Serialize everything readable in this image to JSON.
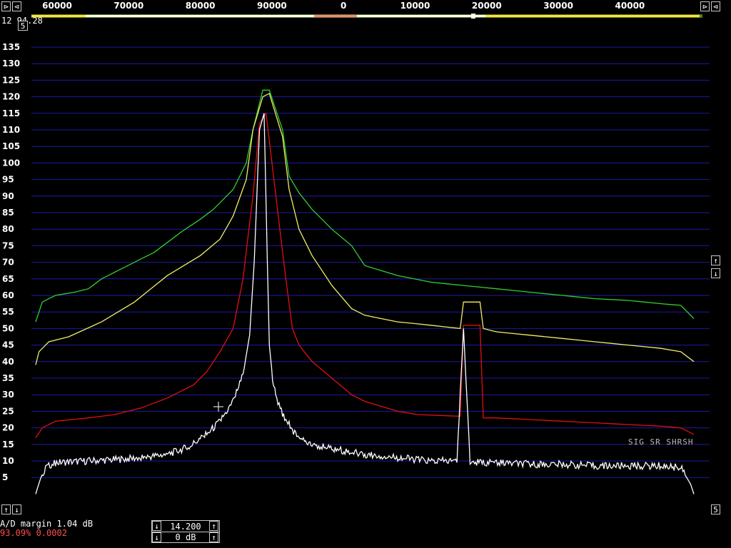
{
  "controls": {
    "left_scroll_top": "⊳",
    "left_arrow_top": "⊲",
    "right_scroll_top": "⊳",
    "right_arrow_top": "⊲",
    "top_readout": "12 94.28",
    "scale_btn_top": "5",
    "up_btn_left": "↑",
    "down_btn_left": "↓",
    "up_btn_right": "↑",
    "down_btn_right": "↓",
    "scale_btn_bottom": "5"
  },
  "status": {
    "ad_margin": "A/D margin  1.04 dB",
    "stats": "93.09% 0.0002",
    "overlay_text": "SIG SR SHRSH"
  },
  "bottom_controls": {
    "frequency": "14.200",
    "gain": "0 dB",
    "up_symbol": "↑",
    "down_symbol": "↓"
  },
  "colors": {
    "background": "#000000",
    "grid": "#1a1aa8",
    "white_trace": "#ffffff",
    "red_trace": "#e01010",
    "yellow_trace": "#f0f060",
    "green_trace": "#30d030"
  },
  "chart_data": {
    "type": "line",
    "x_tick_labels": [
      "60000",
      "70000",
      "80000",
      "90000",
      "0",
      "10000",
      "20000",
      "30000",
      "40000"
    ],
    "y_ticks": [
      135,
      130,
      125,
      120,
      115,
      110,
      105,
      100,
      95,
      90,
      85,
      80,
      75,
      70,
      65,
      60,
      55,
      50,
      45,
      40,
      35,
      30,
      25,
      20,
      15,
      10,
      5
    ],
    "ylim": [
      0,
      140
    ],
    "x_index_range": [
      0,
      100
    ],
    "grid": true,
    "series": [
      {
        "color": "#30d030",
        "x": [
          0,
          1,
          3,
          6,
          8,
          10,
          12,
          15,
          18,
          20,
          22,
          25,
          27,
          30,
          32,
          33,
          34.5,
          35.5,
          37.5,
          38.5,
          40,
          42,
          45,
          48,
          50,
          55,
          60,
          65,
          70,
          75,
          80,
          85,
          90,
          95,
          98,
          100
        ],
        "y": [
          52,
          58,
          60,
          61,
          62,
          65,
          67,
          70,
          73,
          76,
          79,
          83,
          86,
          92,
          100,
          110,
          122,
          122,
          110,
          96,
          91,
          86,
          80,
          75,
          69,
          66,
          64,
          63,
          62,
          61,
          60,
          59,
          58.5,
          57.5,
          57,
          53
        ]
      },
      {
        "color": "#f0f060",
        "x": [
          0,
          0.5,
          2,
          5,
          10,
          15,
          20,
          25,
          28,
          30,
          32,
          33,
          34.5,
          35.5,
          37.5,
          38.5,
          40,
          42,
          45,
          48,
          50,
          55,
          60,
          64.5,
          65,
          67.5,
          68,
          70,
          75,
          80,
          85,
          90,
          95,
          98,
          100
        ],
        "y": [
          39,
          43,
          46,
          47.5,
          52,
          58,
          66,
          72,
          77,
          84,
          95,
          110,
          120,
          121,
          108,
          92,
          80,
          72,
          63,
          56,
          54,
          52,
          51,
          50,
          58,
          58,
          50,
          49,
          48,
          47,
          46,
          45,
          44,
          43,
          40
        ]
      },
      {
        "color": "#e01010",
        "x": [
          0,
          1,
          3,
          8,
          12,
          16,
          20,
          24,
          26,
          28,
          30,
          31.5,
          33,
          34,
          35,
          36.5,
          38,
          39,
          40,
          42,
          45,
          48,
          50,
          55,
          58,
          64.5,
          65,
          67.5,
          68,
          70,
          75,
          80,
          85,
          90,
          95,
          98,
          100
        ],
        "y": [
          17,
          20,
          22,
          23,
          24,
          26,
          29,
          33,
          37,
          43,
          50,
          65,
          90,
          112,
          115,
          90,
          65,
          50,
          45,
          40,
          35,
          30,
          28,
          25,
          24,
          23.5,
          51,
          51,
          23,
          23,
          22.5,
          22,
          21.5,
          21,
          20.5,
          20,
          18
        ]
      },
      {
        "color": "#ffffff",
        "x": [
          0,
          0.3,
          0.8,
          1.5,
          3,
          8,
          13,
          16,
          20,
          23,
          26,
          28,
          30,
          31.5,
          32.5,
          33.2,
          34,
          34.7,
          35.2,
          35.5,
          36,
          36.8,
          37.5,
          38.5,
          39.5,
          41,
          44,
          47,
          50,
          55,
          60,
          64,
          65,
          66,
          67,
          70,
          75,
          80,
          85,
          90,
          95,
          98,
          99.5,
          100
        ],
        "y": [
          0,
          2,
          5,
          8,
          9.5,
          10,
          10.5,
          11,
          12,
          14,
          18,
          22,
          28,
          36,
          48,
          70,
          110,
          115,
          70,
          45,
          35,
          28,
          24,
          21,
          18,
          16,
          14,
          13,
          12,
          11,
          10,
          10,
          50,
          10,
          9.5,
          9.5,
          9,
          9,
          8.5,
          8.5,
          8.5,
          8,
          3,
          0
        ]
      }
    ]
  }
}
